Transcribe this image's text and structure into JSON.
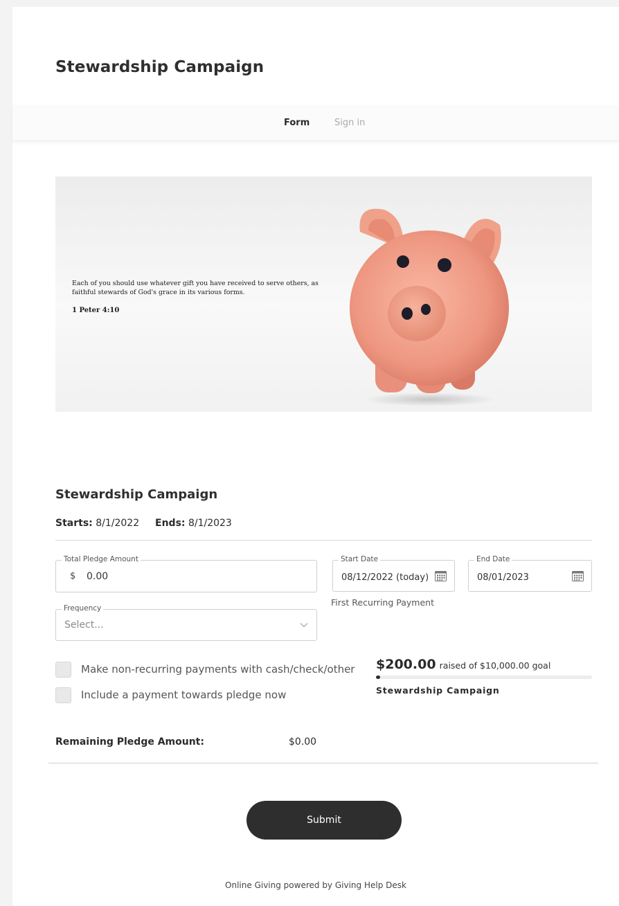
{
  "header": {
    "title": "Stewardship Campaign"
  },
  "nav": {
    "form": "Form",
    "sign_in": "Sign in"
  },
  "hero": {
    "verse": "Each of you should use whatever gift you have received to serve others, as faithful stewards of God's grace in its various forms.",
    "reference": "1 Peter 4:10"
  },
  "campaign": {
    "title": "Stewardship Campaign",
    "starts_label": "Starts:",
    "starts_value": "8/1/2022",
    "ends_label": "Ends:",
    "ends_value": "8/1/2023"
  },
  "form": {
    "pledge": {
      "legend": "Total Pledge Amount",
      "currency": "$",
      "value": "0.00"
    },
    "start_date": {
      "legend": "Start Date",
      "value": "08/12/2022 (today)",
      "icon": "calendar-icon"
    },
    "end_date": {
      "legend": "End Date",
      "value": "08/01/2023",
      "icon": "calendar-icon"
    },
    "first_recurring": "First Recurring Payment",
    "frequency": {
      "legend": "Frequency",
      "placeholder": "Select...",
      "icon": "chevron-down-icon"
    },
    "checkbox_nonrecurring": "Make non-recurring payments with cash/check/other",
    "checkbox_payment_now": "Include a payment towards pledge now",
    "remaining_label": "Remaining Pledge Amount:",
    "remaining_value": "$0.00",
    "submit": "Submit"
  },
  "goal": {
    "raised": "$200.00",
    "goal_text": "raised of $10,000.00 goal",
    "progress_fraction": 0.02,
    "campaign_name": "Stewardship Campaign"
  },
  "footer": {
    "text": "Online Giving powered by Giving Help Desk"
  }
}
